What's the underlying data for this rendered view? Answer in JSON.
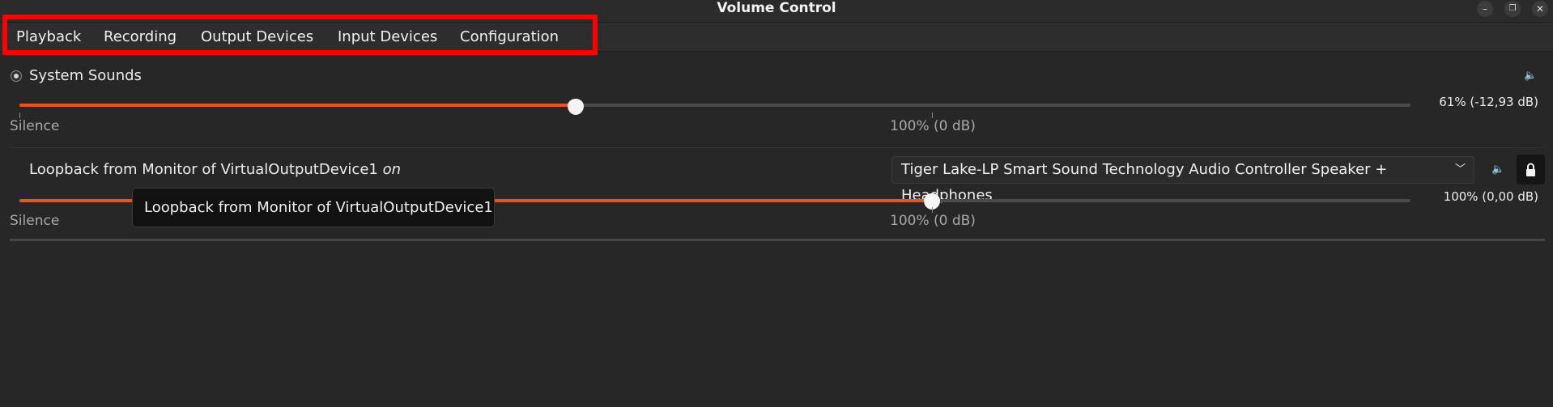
{
  "window": {
    "title": "Volume Control",
    "controls": {
      "minimize": "–",
      "maximize": "❐",
      "close": "✕"
    }
  },
  "tabs": [
    {
      "label": "Playback"
    },
    {
      "label": "Recording"
    },
    {
      "label": "Output Devices"
    },
    {
      "label": "Input Devices"
    },
    {
      "label": "Configuration"
    }
  ],
  "streams": [
    {
      "name": "System Sounds",
      "icon": "radio-icon",
      "volume_percent": 61,
      "volume_text": "61% (-12,93 dB)",
      "scale_min_label": "Silence",
      "scale_mid_label": "100% (0 dB)"
    },
    {
      "name": "Loopback from Monitor of VirtualOutputDevice1",
      "connector": "on",
      "device": "Tiger Lake-LP Smart Sound Technology Audio Controller Speaker + Headphones",
      "volume_percent": 100,
      "volume_text": "100% (0,00 dB)",
      "scale_min_label": "Silence",
      "scale_mid_label": "100% (0 dB)",
      "locked": true
    }
  ],
  "tooltip": {
    "text": "Loopback from Monitor of VirtualOutputDevice1"
  },
  "colors": {
    "accent": "#e95420",
    "highlight_box": "#ff0000",
    "background": "#272727"
  }
}
